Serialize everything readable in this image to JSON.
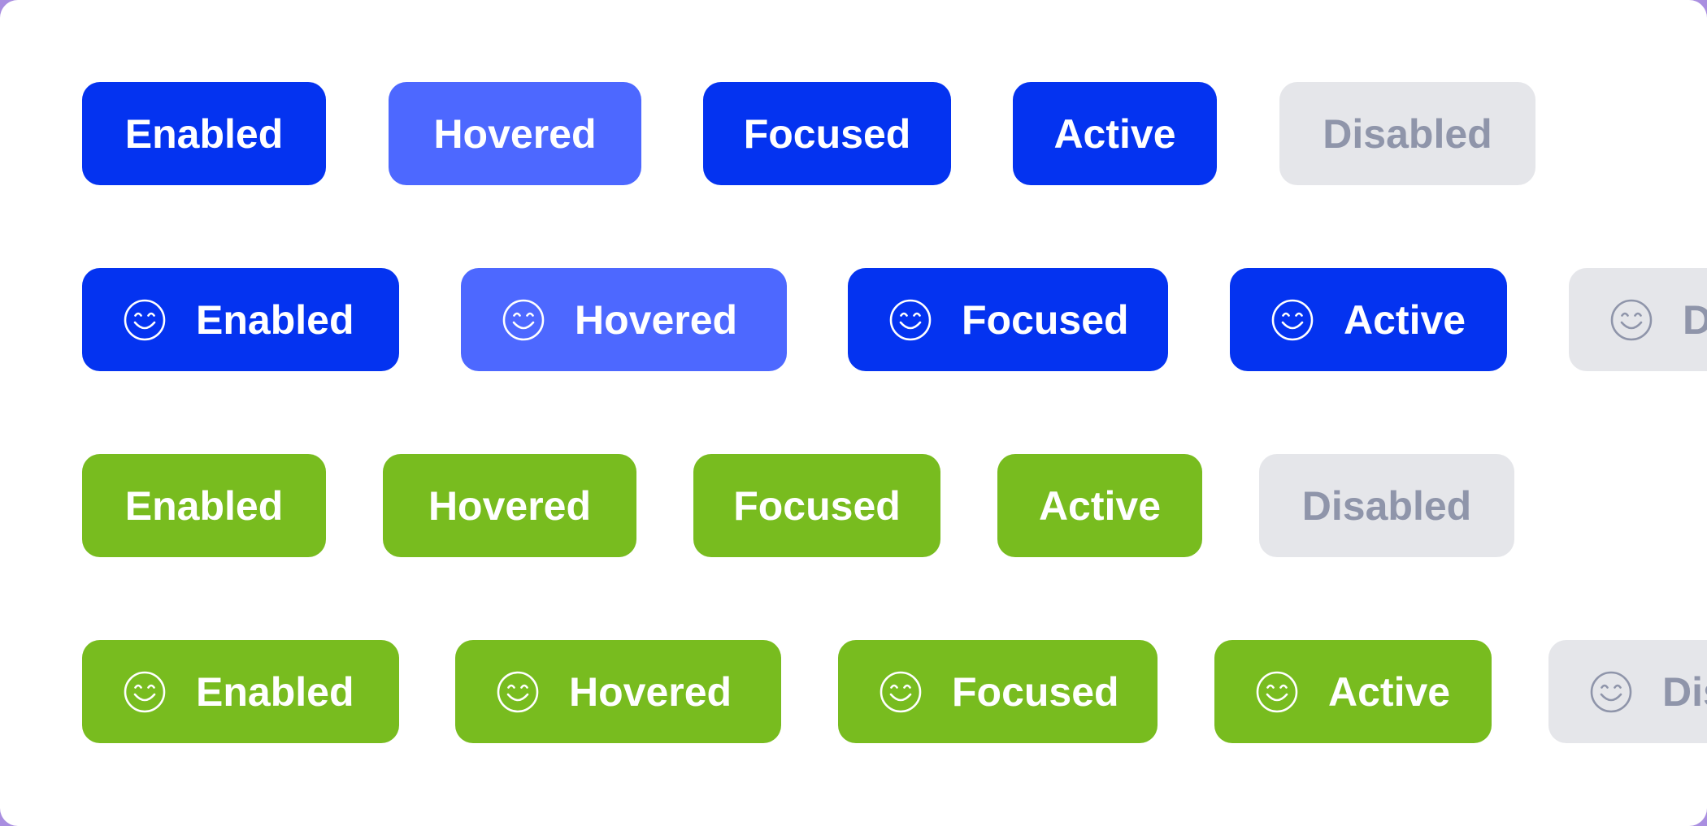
{
  "colors": {
    "blue": "#0433f0",
    "blue_hovered": "#4d68ff",
    "green": "#78bc1f",
    "disabled_bg": "#e5e6ea",
    "disabled_text": "#8f95aa",
    "background": "#ffffff"
  },
  "rows": [
    {
      "variant": "blue",
      "has_icon": false,
      "buttons": [
        {
          "state": "enabled",
          "label": "Enabled"
        },
        {
          "state": "hovered",
          "label": "Hovered"
        },
        {
          "state": "focused",
          "label": "Focused"
        },
        {
          "state": "active",
          "label": "Active"
        },
        {
          "state": "disabled",
          "label": "Disabled"
        }
      ]
    },
    {
      "variant": "blue",
      "has_icon": true,
      "icon": "smiley-icon",
      "buttons": [
        {
          "state": "enabled",
          "label": "Enabled"
        },
        {
          "state": "hovered",
          "label": "Hovered"
        },
        {
          "state": "focused",
          "label": "Focused"
        },
        {
          "state": "active",
          "label": "Active"
        },
        {
          "state": "disabled",
          "label": "D"
        }
      ]
    },
    {
      "variant": "green",
      "has_icon": false,
      "buttons": [
        {
          "state": "enabled",
          "label": "Enabled"
        },
        {
          "state": "hovered",
          "label": "Hovered"
        },
        {
          "state": "focused",
          "label": "Focused"
        },
        {
          "state": "active",
          "label": "Active"
        },
        {
          "state": "disabled",
          "label": "Disabled"
        }
      ]
    },
    {
      "variant": "green",
      "has_icon": true,
      "icon": "smiley-icon",
      "buttons": [
        {
          "state": "enabled",
          "label": "Enabled"
        },
        {
          "state": "hovered",
          "label": "Hovered"
        },
        {
          "state": "focused",
          "label": "Focused"
        },
        {
          "state": "active",
          "label": "Active"
        },
        {
          "state": "disabled",
          "label": "Dis"
        }
      ]
    }
  ]
}
